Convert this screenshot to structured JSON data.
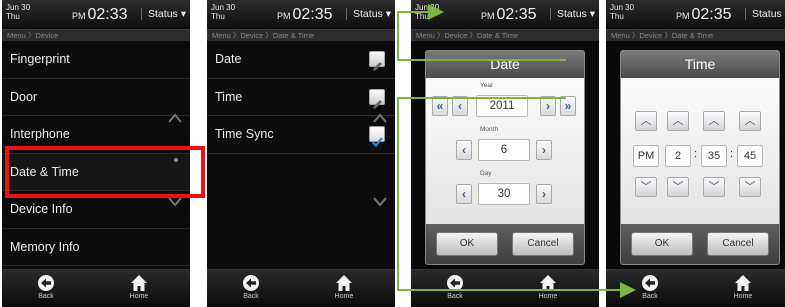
{
  "screens": [
    {
      "date_month": "Jun 30",
      "date_weekday": "Thu",
      "ampm": "PM",
      "time": "02:33",
      "status_label": "Status",
      "breadcrumb": "Menu 〉Device",
      "menu": [
        "Fingerprint",
        "Door",
        "Interphone",
        "Date & Time",
        "Device Info",
        "Memory Info"
      ],
      "nav": {
        "back": "Back",
        "home": "Home"
      }
    },
    {
      "date_month": "Jun 30",
      "date_weekday": "Thu",
      "ampm": "PM",
      "time": "02:35",
      "status_label": "Status",
      "breadcrumb": "Menu 〉Device 〉Date & Time",
      "menu": [
        "Date",
        "Time",
        "Time Sync"
      ],
      "nav": {
        "back": "Back",
        "home": "Home"
      }
    },
    {
      "date_month": "Jun 30",
      "date_weekday": "Thu",
      "ampm": "PM",
      "time": "02:35",
      "status_label": "Status",
      "breadcrumb": "Menu 〉Device 〉Date & Time",
      "dialog": {
        "title": "Date",
        "year_label": "Year",
        "year": "2011",
        "month_label": "Month",
        "month": "6",
        "day_label": "Day",
        "day": "30",
        "ok": "OK",
        "cancel": "Cancel"
      },
      "nav": {
        "back": "Back",
        "home": "Home"
      }
    },
    {
      "date_month": "Jun 30",
      "date_weekday": "Thu",
      "ampm": "PM",
      "time": "02:35",
      "status_label": "Status",
      "breadcrumb": "Menu 〉Device 〉Date & Time",
      "dialog": {
        "title": "Time",
        "ampm": "PM",
        "hour": "2",
        "minute": "35",
        "second": "45",
        "ok": "OK",
        "cancel": "Cancel"
      },
      "nav": {
        "back": "Back",
        "home": "Home"
      }
    }
  ],
  "colors": {
    "highlight": "#ee1111",
    "connector": "#7db542"
  }
}
